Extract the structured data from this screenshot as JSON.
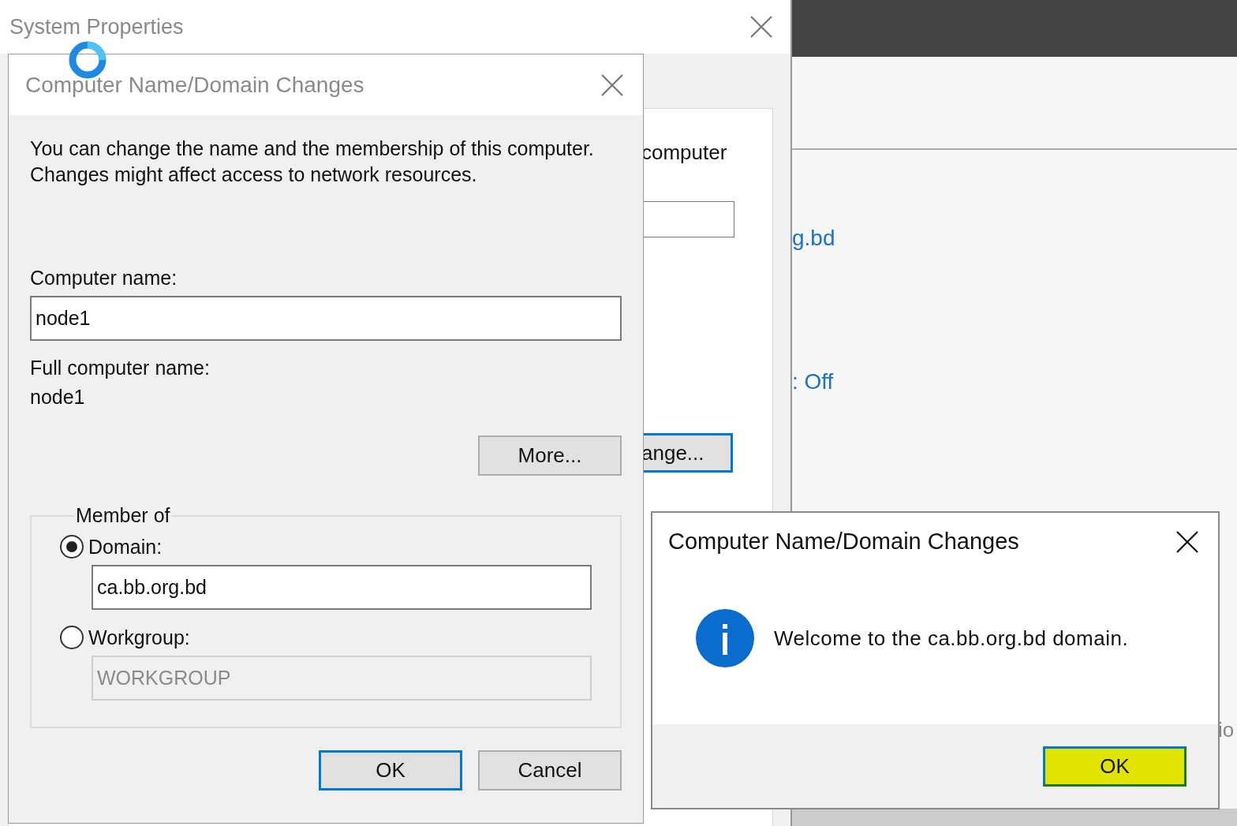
{
  "background_window": {
    "title": "System Properties",
    "panel_text": "computer",
    "panel_button": "ange...",
    "panel_button_default": true
  },
  "side_window": {
    "links": [
      {
        "text": "g.bd"
      },
      {
        "text": ": Off"
      }
    ],
    "fragment": "io"
  },
  "dialog": {
    "title": "Computer Name/Domain Changes",
    "active": false,
    "busy": true,
    "description": "You can change the name and the membership of this computer. Changes might affect access to network resources.",
    "computer_name_label": "Computer name:",
    "computer_name": "node1",
    "full_name_label": "Full computer name:",
    "full_name": "node1",
    "more_button": "More...",
    "member_of": {
      "label": "Member of",
      "options": [
        {
          "label": "Domain:",
          "selected": true,
          "value": "ca.bb.org.bd",
          "disabled": false
        },
        {
          "label": "Workgroup:",
          "selected": false,
          "value": "WORKGROUP",
          "disabled": true
        }
      ]
    },
    "buttons": [
      {
        "label": "OK",
        "default": true
      },
      {
        "label": "Cancel",
        "default": false
      }
    ]
  },
  "message_box": {
    "title": "Computer Name/Domain Changes",
    "active": true,
    "message": "Welcome to the ca.bb.org.bd domain.",
    "buttons": [
      {
        "label": "OK",
        "default": true,
        "highlighted": true
      }
    ]
  }
}
